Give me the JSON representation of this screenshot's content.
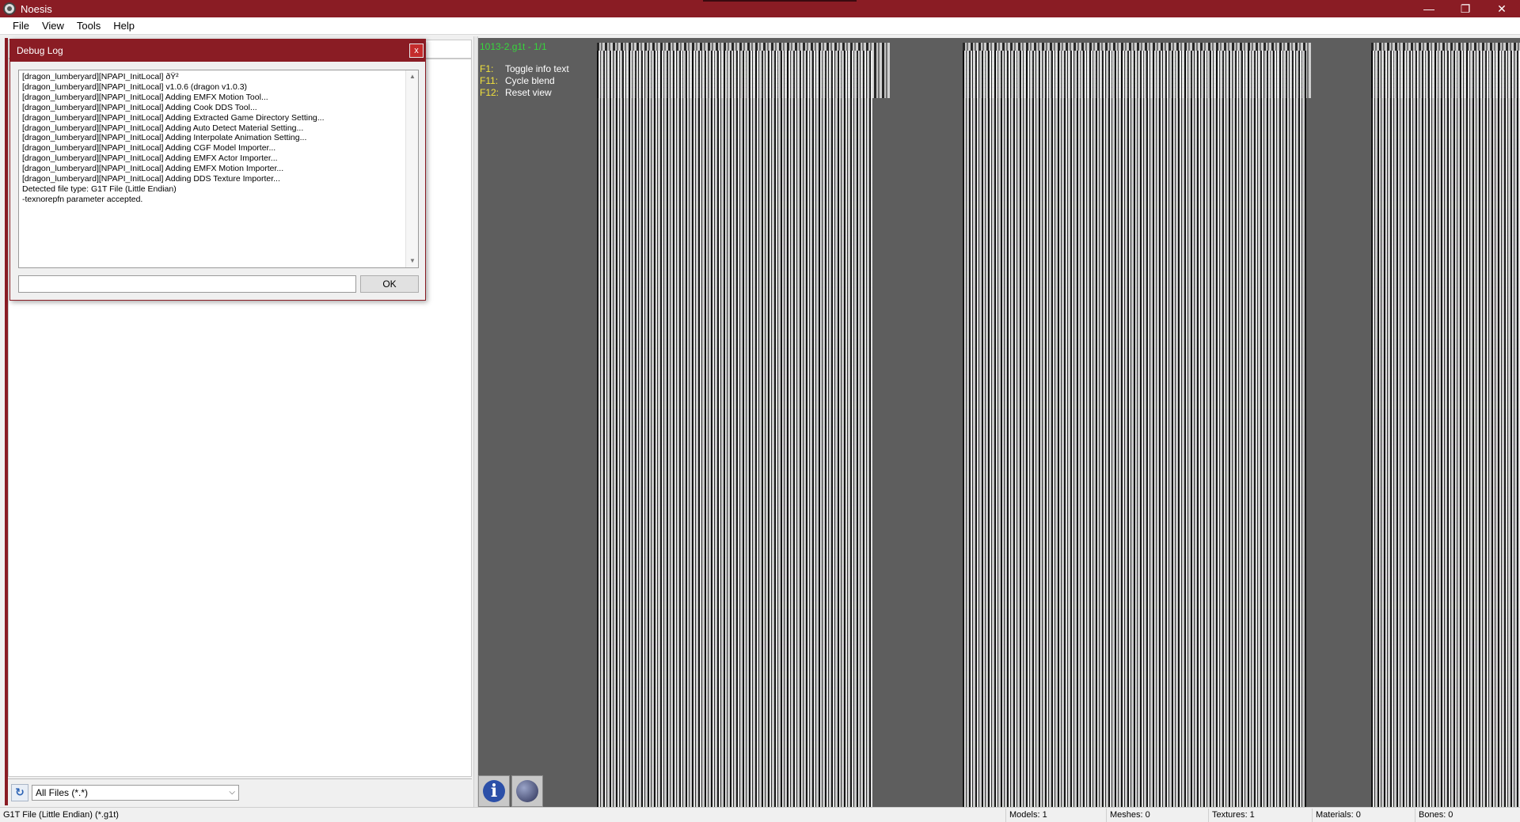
{
  "window": {
    "title": "Noesis",
    "minimize_glyph": "—",
    "restore_glyph": "❐",
    "close_glyph": "✕"
  },
  "menu": {
    "items": [
      {
        "label": "File"
      },
      {
        "label": "View"
      },
      {
        "label": "Tools"
      },
      {
        "label": "Help"
      }
    ]
  },
  "left_panel": {
    "filter_select": {
      "value": "All Files (*.*)"
    },
    "refresh_icon": "refresh-icon"
  },
  "viewport": {
    "title": "1013-2.g1t - 1/1",
    "keys": [
      {
        "key": "F1:",
        "desc": "Toggle info text"
      },
      {
        "key": "F11:",
        "desc": "Cycle blend"
      },
      {
        "key": "F12:",
        "desc": "Reset view"
      }
    ],
    "info_glyph": "i"
  },
  "dialog": {
    "title": "Debug Log",
    "close_glyph": "x",
    "log_lines": [
      "[dragon_lumberyard][NPAPI_InitLocal] ðŸ²",
      "[dragon_lumberyard][NPAPI_InitLocal] v1.0.6 (dragon v1.0.3)",
      "[dragon_lumberyard][NPAPI_InitLocal] Adding EMFX Motion Tool...",
      "[dragon_lumberyard][NPAPI_InitLocal] Adding Cook DDS Tool...",
      "[dragon_lumberyard][NPAPI_InitLocal] Adding Extracted Game Directory Setting...",
      "[dragon_lumberyard][NPAPI_InitLocal] Adding Auto Detect Material Setting...",
      "[dragon_lumberyard][NPAPI_InitLocal] Adding Interpolate Animation Setting...",
      "[dragon_lumberyard][NPAPI_InitLocal] Adding CGF Model Importer...",
      "[dragon_lumberyard][NPAPI_InitLocal] Adding EMFX Actor Importer...",
      "[dragon_lumberyard][NPAPI_InitLocal] Adding EMFX Motion Importer...",
      "[dragon_lumberyard][NPAPI_InitLocal] Adding DDS Texture Importer...",
      "Detected file type: G1T File (Little Endian)",
      "-texnorepfn parameter accepted."
    ],
    "command_value": "",
    "ok_label": "OK"
  },
  "status": {
    "file_type": "G1T File (Little Endian) (*.g1t)",
    "models": "Models: 1",
    "meshes": "Meshes: 0",
    "textures": "Textures: 1",
    "materials": "Materials: 0",
    "bones": "Bones: 0"
  },
  "colors": {
    "titlebar": "#8a1c24",
    "viewport_bg": "#5e5e5e",
    "viewport_title": "#37d63c",
    "key_color": "#f2e23c"
  }
}
